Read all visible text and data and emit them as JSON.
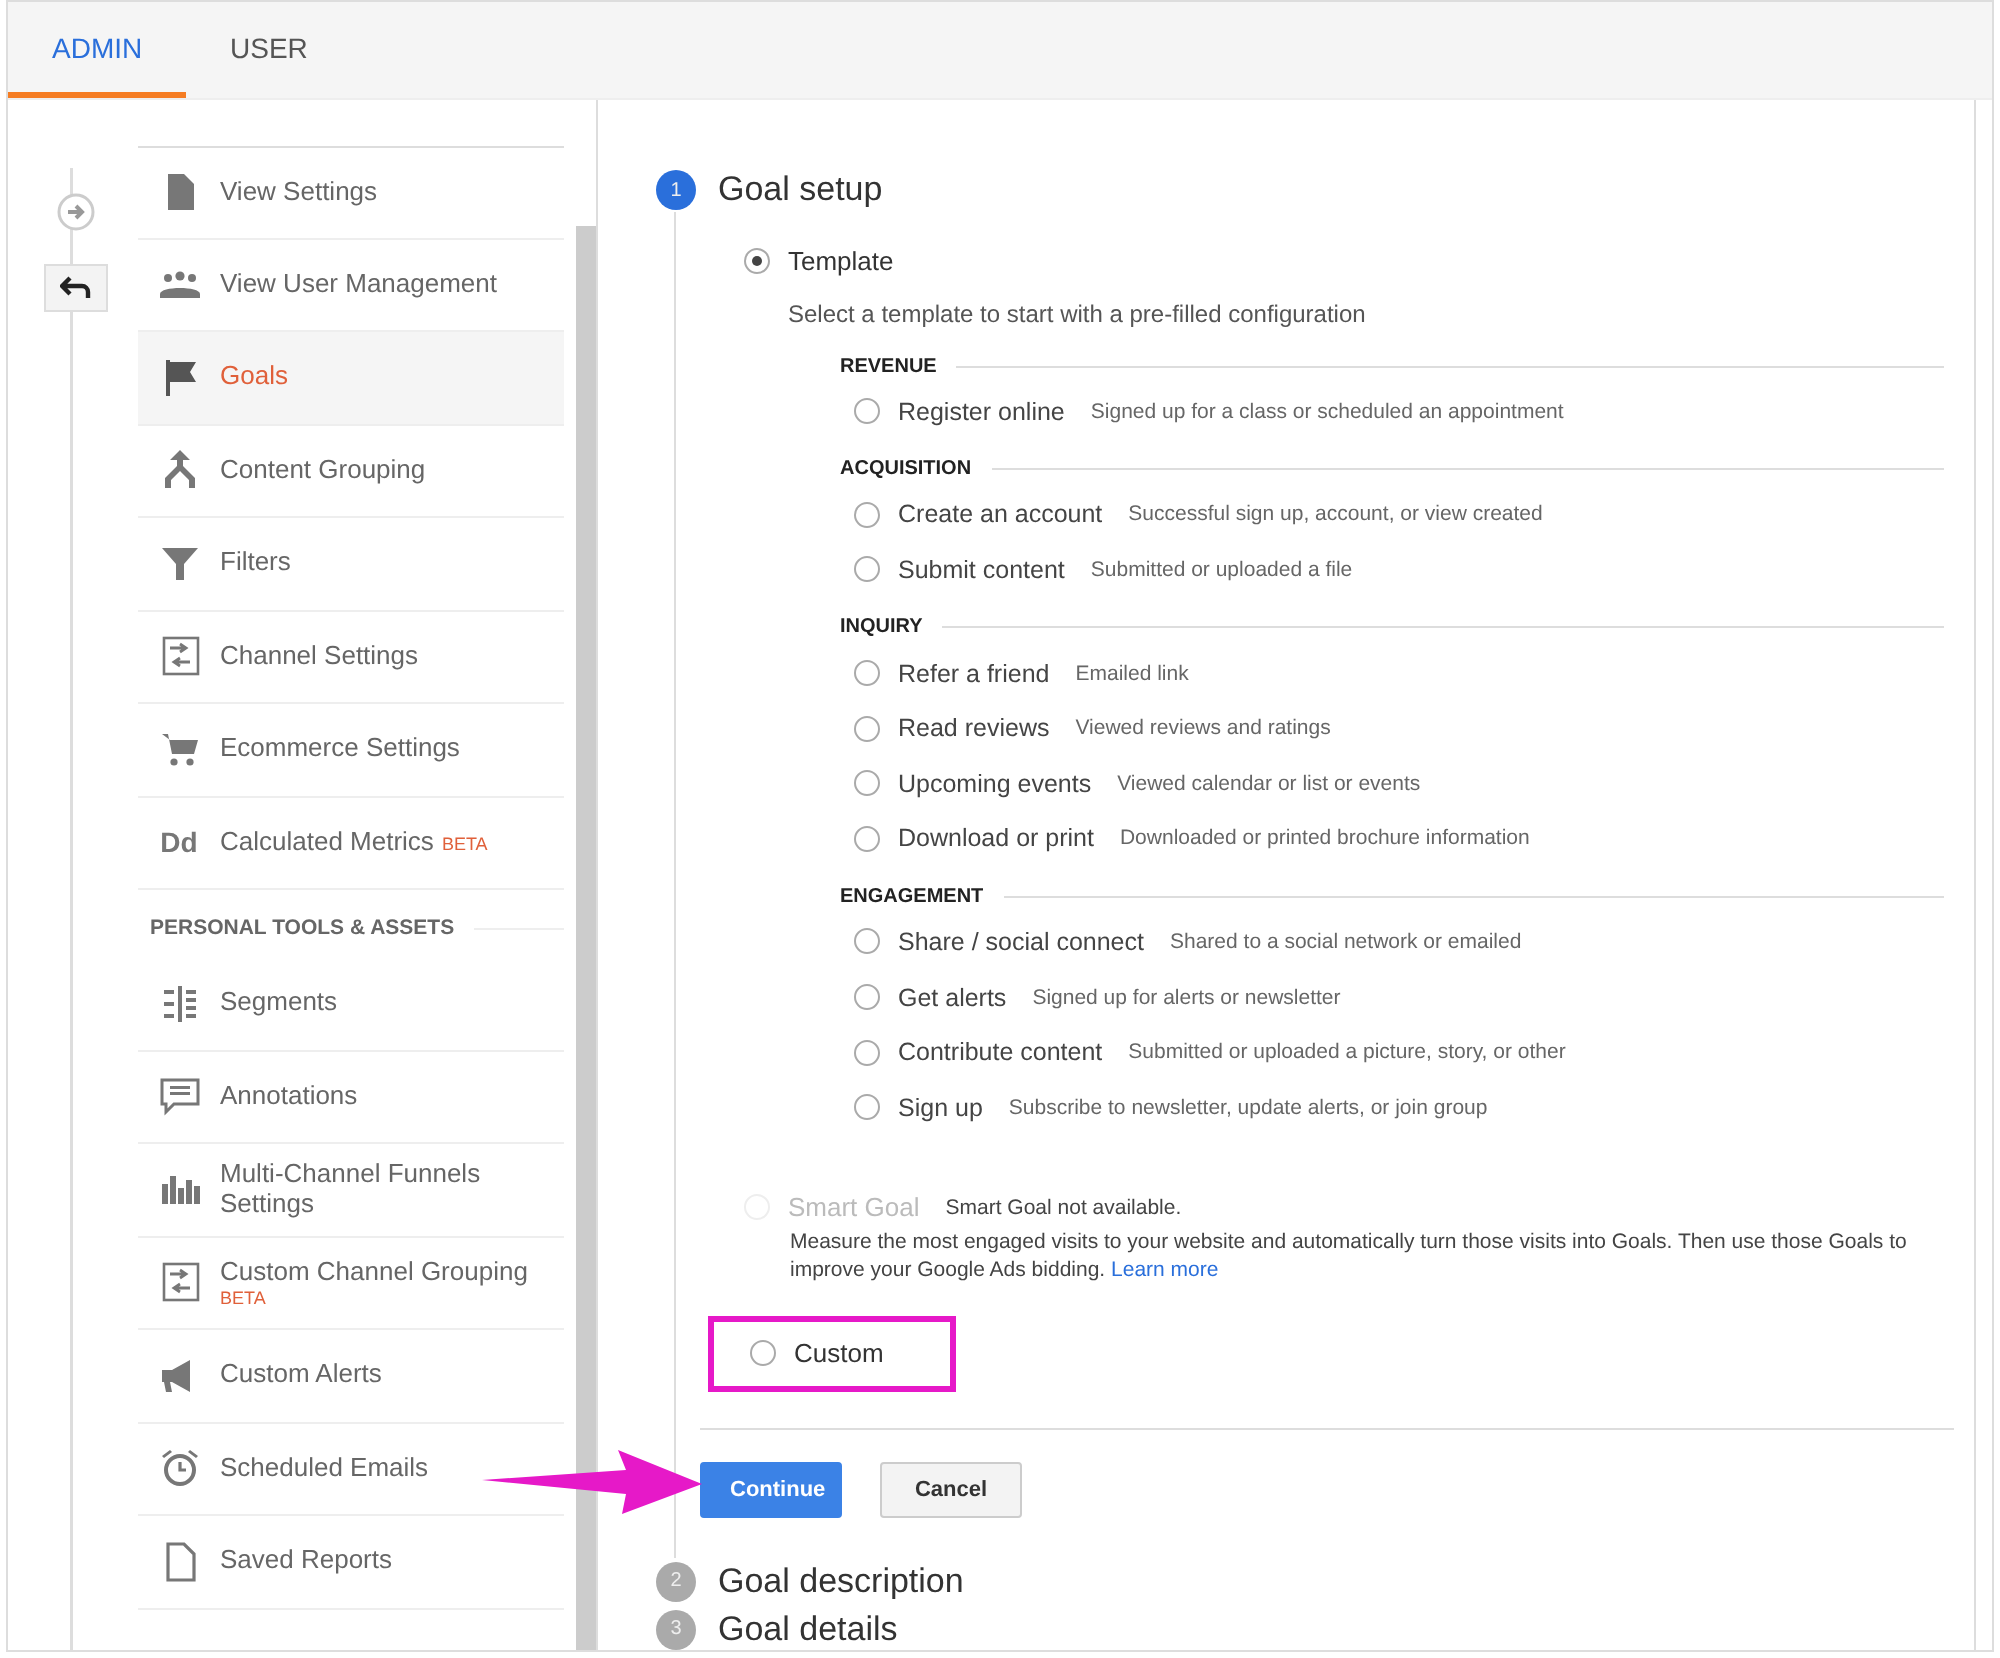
{
  "tabs": [
    {
      "label": "ADMIN",
      "selected": true
    },
    {
      "label": "USER",
      "selected": false
    }
  ],
  "sidebar": {
    "items": [
      {
        "kind": "item",
        "label": "View Settings",
        "selected": false
      },
      {
        "kind": "item",
        "label": "View User Management",
        "selected": false
      },
      {
        "kind": "item",
        "label": "Goals",
        "selected": true
      },
      {
        "kind": "item",
        "label": "Content Grouping",
        "selected": false
      },
      {
        "kind": "item",
        "label": "Filters",
        "selected": false
      },
      {
        "kind": "item",
        "label": "Channel Settings",
        "selected": false
      },
      {
        "kind": "item",
        "label": "Ecommerce Settings",
        "selected": false
      },
      {
        "kind": "item",
        "icon_text": "Dd",
        "label": "Calculated Metrics",
        "badge": "BETA",
        "selected": false
      },
      {
        "kind": "section",
        "label": "PERSONAL TOOLS & ASSETS"
      },
      {
        "kind": "item",
        "label": "Segments",
        "selected": false
      },
      {
        "kind": "item",
        "label": "Annotations",
        "selected": false
      },
      {
        "kind": "item",
        "label": "Multi-Channel Funnels Settings",
        "selected": false
      },
      {
        "kind": "item",
        "label": "Custom Channel Grouping",
        "badge": "BETA",
        "selected": false
      },
      {
        "kind": "item",
        "label": "Custom Alerts",
        "selected": false
      },
      {
        "kind": "item",
        "label": "Scheduled Emails",
        "selected": false
      },
      {
        "kind": "item",
        "label": "Saved Reports",
        "selected": false
      }
    ]
  },
  "steps": [
    {
      "number": "1",
      "title": "Goal setup",
      "active": true
    },
    {
      "number": "2",
      "title": "Goal description",
      "active": false
    },
    {
      "number": "3",
      "title": "Goal details",
      "active": false
    }
  ],
  "goal_setup": {
    "template": {
      "label": "Template",
      "selected": true
    },
    "template_hint": "Select a template to start with a pre-filled configuration",
    "categories": [
      {
        "title": "REVENUE",
        "options": [
          {
            "label": "Register online",
            "description": "Signed up for a class or scheduled an appointment",
            "selected": false
          }
        ]
      },
      {
        "title": "ACQUISITION",
        "options": [
          {
            "label": "Create an account",
            "description": "Successful sign up, account, or view created",
            "selected": false
          },
          {
            "label": "Submit content",
            "description": "Submitted or uploaded a file",
            "selected": false
          }
        ]
      },
      {
        "title": "INQUIRY",
        "options": [
          {
            "label": "Refer a friend",
            "description": "Emailed link",
            "selected": false
          },
          {
            "label": "Read reviews",
            "description": "Viewed reviews and ratings",
            "selected": false
          },
          {
            "label": "Upcoming events",
            "description": "Viewed calendar or list or events",
            "selected": false
          },
          {
            "label": "Download or print",
            "description": "Downloaded or printed brochure information",
            "selected": false
          }
        ]
      },
      {
        "title": "ENGAGEMENT",
        "options": [
          {
            "label": "Share / social connect",
            "description": "Shared to a social network or emailed",
            "selected": false
          },
          {
            "label": "Get alerts",
            "description": "Signed up for alerts or newsletter",
            "selected": false
          },
          {
            "label": "Contribute content",
            "description": "Submitted or uploaded a picture, story, or other",
            "selected": false
          },
          {
            "label": "Sign up",
            "description": "Subscribe to newsletter, update alerts, or join group",
            "selected": false
          }
        ]
      }
    ],
    "smart_goal": {
      "label": "Smart Goal",
      "note": "Smart Goal not available.",
      "disabled": true,
      "selected": false,
      "description": "Measure the most engaged visits to your website and automatically turn those visits into Goals. Then use those Goals to improve your Google Ads bidding.",
      "link": "Learn more"
    },
    "custom": {
      "label": "Custom",
      "selected": false,
      "highlighted": true
    }
  },
  "buttons": [
    {
      "kind": "primary",
      "label": "Continue"
    },
    {
      "kind": "secondary",
      "label": "Cancel"
    }
  ]
}
